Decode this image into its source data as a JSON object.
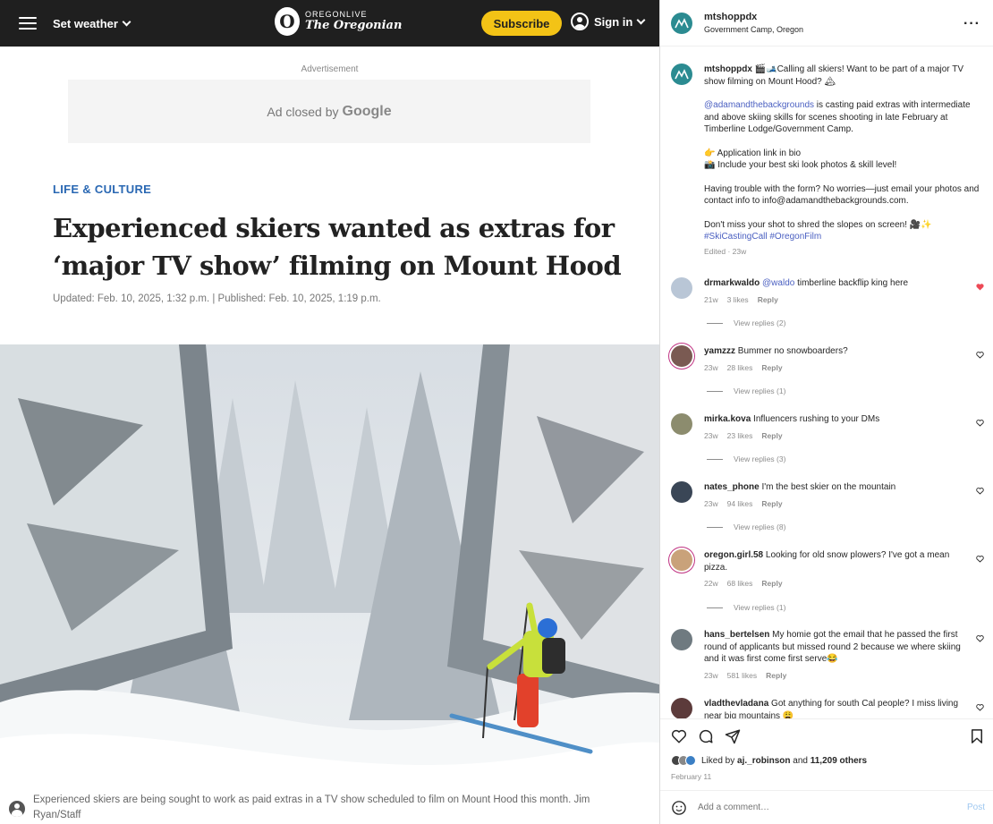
{
  "article": {
    "topbar": {
      "weather_label": "Set weather",
      "logo_small": "OREGONLIVE",
      "logo_big": "The Oregonian",
      "logo_mark": "O",
      "subscribe_label": "Subscribe",
      "signin_label": "Sign in"
    },
    "ad": {
      "label": "Advertisement",
      "closed_text": "Ad closed by",
      "closed_brand": "Google"
    },
    "category": "LIFE & CULTURE",
    "headline": "Experienced skiers wanted as extras for ‘major TV show’ filming on Mount Hood",
    "dateline": "Updated: Feb. 10, 2025, 1:32 p.m. | Published: Feb. 10, 2025, 1:19 p.m.",
    "photo_caption": "Experienced skiers are being sought to work as paid extras in a TV show scheduled to film on Mount Hood this month. Jim Ryan/Staff"
  },
  "instagram": {
    "header": {
      "username": "mtshoppdx",
      "location": "Government Camp, Oregon",
      "more_icon": "more-dots-icon"
    },
    "caption": {
      "username": "mtshoppdx",
      "line1": "🎬🎿Calling all skiers! Want to be part of a major TV show filming on Mount Hood? 🏔",
      "mention": "@adamandthebackgrounds",
      "line2": " is casting paid extras with intermediate and above skiing skills for scenes shooting in late February at Timberline Lodge/Government Camp.",
      "line3": "👉 Application link in bio",
      "line4": "📸 Include your best ski look photos & skill level!",
      "line5": "Having trouble with the form? No worries—just email your photos and contact info to info@adamandthebackgrounds.com.",
      "line6": "Don't miss your shot to shred the slopes on screen! 🎥✨",
      "hashtags": "#SkiCastingCall #OregonFilm",
      "meta": "Edited · 23w"
    },
    "comments": [
      {
        "username": "drmarkwaldo",
        "mention": "@waldo",
        "text": " timberline backflip king here",
        "age": "21w",
        "likes": "3 likes",
        "reply": "Reply",
        "replies": "View replies (2)",
        "liked": true,
        "avatar_color": "#b9c6d6"
      },
      {
        "username": "yamzzz",
        "mention": "",
        "text": "Bummer no snowboarders?",
        "age": "23w",
        "likes": "28 likes",
        "reply": "Reply",
        "replies": "View replies (1)",
        "liked": false,
        "avatar_color": "#7a5a52"
      },
      {
        "username": "mirka.kova",
        "mention": "",
        "text": "Influencers rushing to your DMs",
        "age": "23w",
        "likes": "23 likes",
        "reply": "Reply",
        "replies": "View replies (3)",
        "liked": false,
        "avatar_color": "#8c8c6e"
      },
      {
        "username": "nates_phone",
        "mention": "",
        "text": "I'm the best skier on the mountain",
        "age": "23w",
        "likes": "94 likes",
        "reply": "Reply",
        "replies": "View replies (8)",
        "liked": false,
        "avatar_color": "#3a4656"
      },
      {
        "username": "oregon.girl.58",
        "mention": "",
        "text": "Looking for old snow plowers? I've got a mean pizza.",
        "age": "22w",
        "likes": "68 likes",
        "reply": "Reply",
        "replies": "View replies (1)",
        "liked": false,
        "avatar_color": "#c9a27a"
      },
      {
        "username": "hans_bertelsen",
        "mention": "",
        "text": "My homie got the email that he passed the first round of applicants but missed round 2 because we where skiing and it was first come first serve😂",
        "age": "23w",
        "likes": "581 likes",
        "reply": "Reply",
        "replies": "",
        "liked": false,
        "avatar_color": "#6f7a80"
      },
      {
        "username": "vladthevladana",
        "mention": "",
        "text": "Got anything for south Cal people? I miss living near big mountains 😩",
        "age": "",
        "likes": "",
        "reply": "",
        "replies": "",
        "liked": false,
        "avatar_color": "#5c3b3b"
      }
    ],
    "likes": {
      "prefix": "Liked by ",
      "user": "aj._robinson",
      "middle": " and ",
      "count": "11,209 others"
    },
    "post_date": "February 11",
    "comment_placeholder": "Add a comment…",
    "post_label": "Post",
    "colors": {
      "accent": "#4a5fc1",
      "heart": "#ed4956",
      "brand_avatar": "#2b8b91",
      "subscribe": "#f3c316",
      "category": "#2a68b3"
    }
  }
}
